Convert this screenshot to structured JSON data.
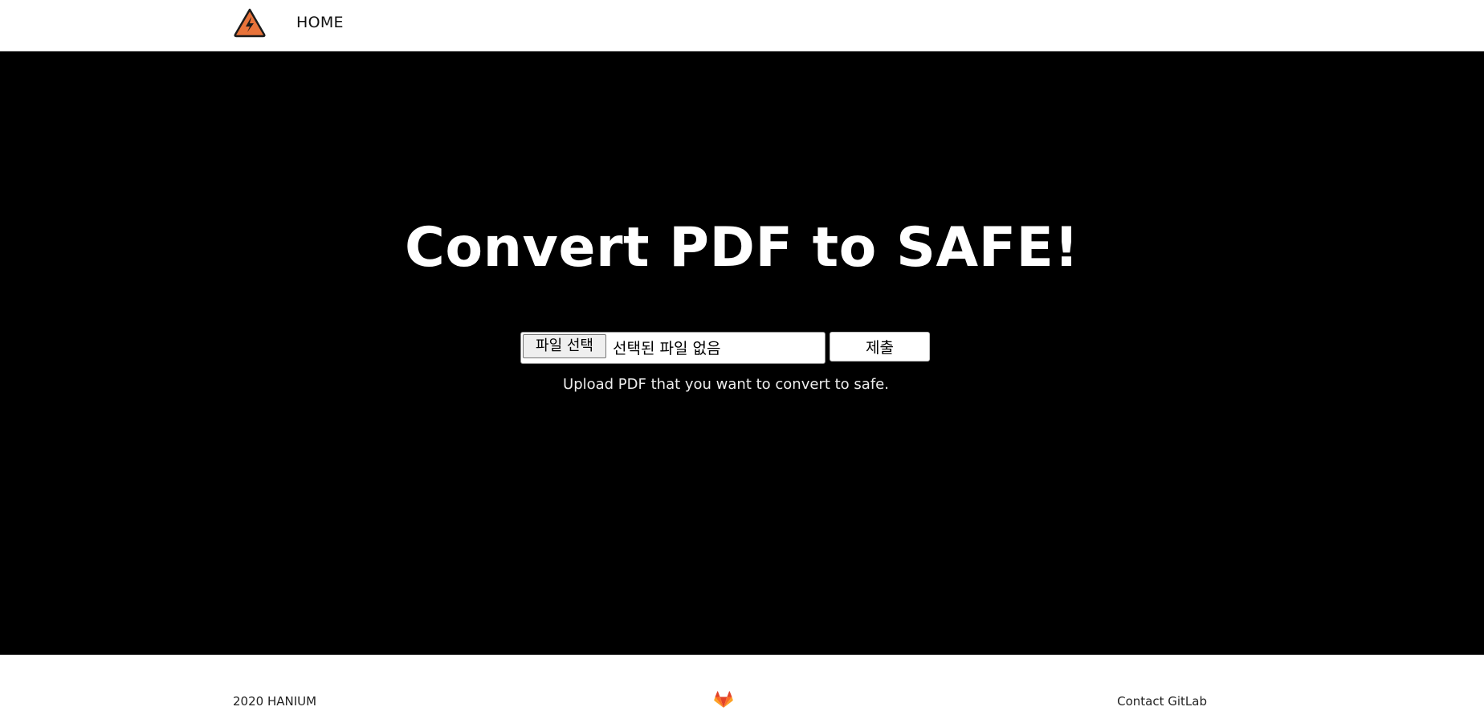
{
  "nav": {
    "logo_icon": "high-voltage-warning-icon",
    "home_label": "HOME"
  },
  "hero": {
    "title": "Convert PDF to SAFE!",
    "file_input": {
      "choose_label": "파일 선택",
      "status": "선택된 파일 없음"
    },
    "submit_label": "제출",
    "help_text": "Upload PDF that you want to convert to safe."
  },
  "footer": {
    "copyright": "2020 HANIUM",
    "center_icon": "gitlab-icon",
    "contact_label": "Contact GitLab"
  },
  "colors": {
    "hero_background": "#000000",
    "logo_orange": "#e8733a",
    "gitlab_orange": "#e24329"
  }
}
